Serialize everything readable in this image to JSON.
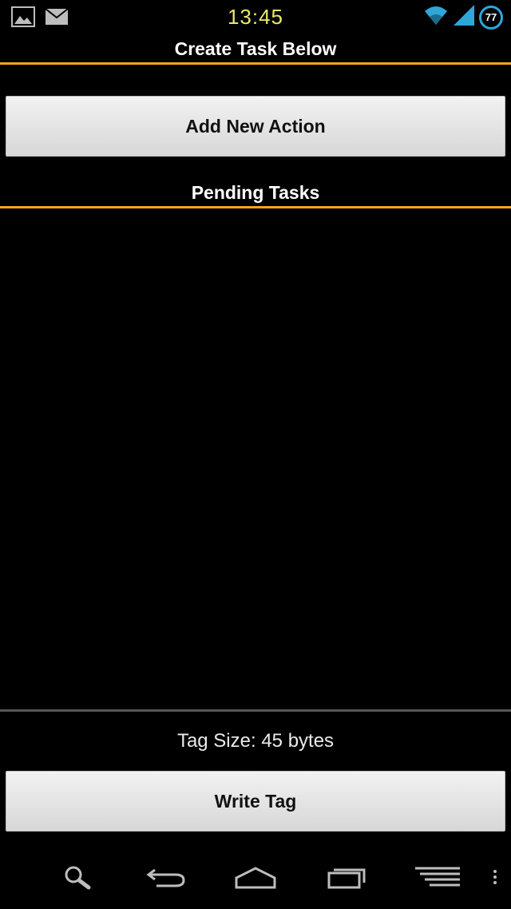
{
  "status_bar": {
    "time": "13:45",
    "battery_level": "77",
    "icons": [
      "image-icon",
      "mail-icon",
      "wifi-icon",
      "signal-icon",
      "battery-icon"
    ]
  },
  "header": {
    "title": "Create Task Below"
  },
  "actions": {
    "add_new_action_label": "Add New Action"
  },
  "pending": {
    "title": "Pending Tasks",
    "items": []
  },
  "footer": {
    "tag_size": "Tag Size: 45 bytes",
    "write_tag_label": "Write Tag"
  },
  "nav_bar": {
    "icons": [
      "search-icon",
      "back-icon",
      "home-icon",
      "recent-apps-icon",
      "menu-icon",
      "overflow-icon"
    ]
  },
  "colors": {
    "accent": "#f3a617",
    "clock": "#e9e96a",
    "battery_ring": "#2fa6d8",
    "background": "#000000"
  }
}
